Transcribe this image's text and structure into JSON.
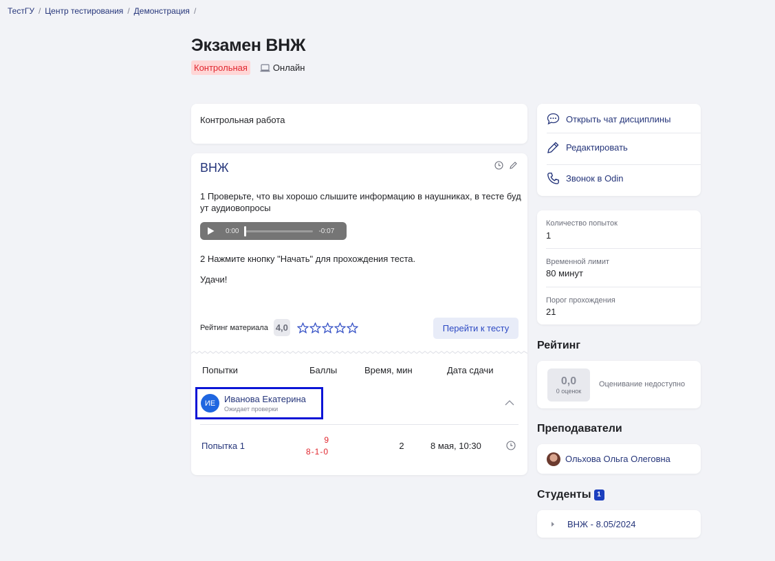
{
  "breadcrumb": [
    {
      "label": "ТестГУ"
    },
    {
      "label": "Центр тестирования"
    },
    {
      "label": "Демонстрация"
    }
  ],
  "breadcrumb_sep": "/",
  "page": {
    "title": "Экзамен ВНЖ",
    "tag_control": "Контрольная",
    "tag_online": "Онлайн"
  },
  "description": "Контрольная работа",
  "material": {
    "title": "ВНЖ",
    "paragraph1": "1 Проверьте, что вы хорошо слышите  информацию в наушниках, в тесте буд ут аудиовопросы",
    "audio": {
      "current": "0:00",
      "remaining": "-0:07"
    },
    "paragraph2": "2 Нажмите кнопку \"Начать\" для прохождения теста.",
    "paragraph3": "Удачи!",
    "rating_label": "Рейтинг материала",
    "rating_value": "4,0",
    "stars_total": 5,
    "goto_button": "Перейти к тесту"
  },
  "attempts_table": {
    "headers": {
      "attempts": "Попытки",
      "score": "Баллы",
      "time": "Время, мин",
      "date": "Дата сдачи"
    },
    "student": {
      "initials": "ИЕ",
      "name": "Иванова Екатерина",
      "status": "Ожидает проверки"
    },
    "rows": [
      {
        "label": "Попытка 1",
        "score": "9",
        "score_detail": "8-1-0",
        "time": "2",
        "date": "8 мая, 10:30"
      }
    ]
  },
  "side_actions": [
    {
      "label": "Открыть чат дисциплины",
      "icon": "chat-icon"
    },
    {
      "label": "Редактировать",
      "icon": "pencil-icon"
    },
    {
      "label": "Звонок в Odin",
      "icon": "phone-icon"
    }
  ],
  "info": {
    "attempts_label": "Количество попыток",
    "attempts_value": "1",
    "time_limit_label": "Временной лимит",
    "time_limit_value": "80 минут",
    "threshold_label": "Порог прохождения",
    "threshold_value": "21"
  },
  "rating": {
    "section_title": "Рейтинг",
    "value": "0,0",
    "count": "0 оценок",
    "note": "Оценивание недоступно"
  },
  "teachers": {
    "section_title": "Преподаватели",
    "items": [
      {
        "name": "Ольхова Ольга Олеговна"
      }
    ]
  },
  "students": {
    "section_title": "Студенты",
    "badge": "1",
    "groups": [
      {
        "name": "ВНЖ - 8.05/2024"
      }
    ]
  },
  "colors": {
    "link": "#25357a",
    "accent": "#2c49c3",
    "danger": "#e0262e",
    "highlight_border": "#0a14d6",
    "background": "#f2f3f7"
  }
}
